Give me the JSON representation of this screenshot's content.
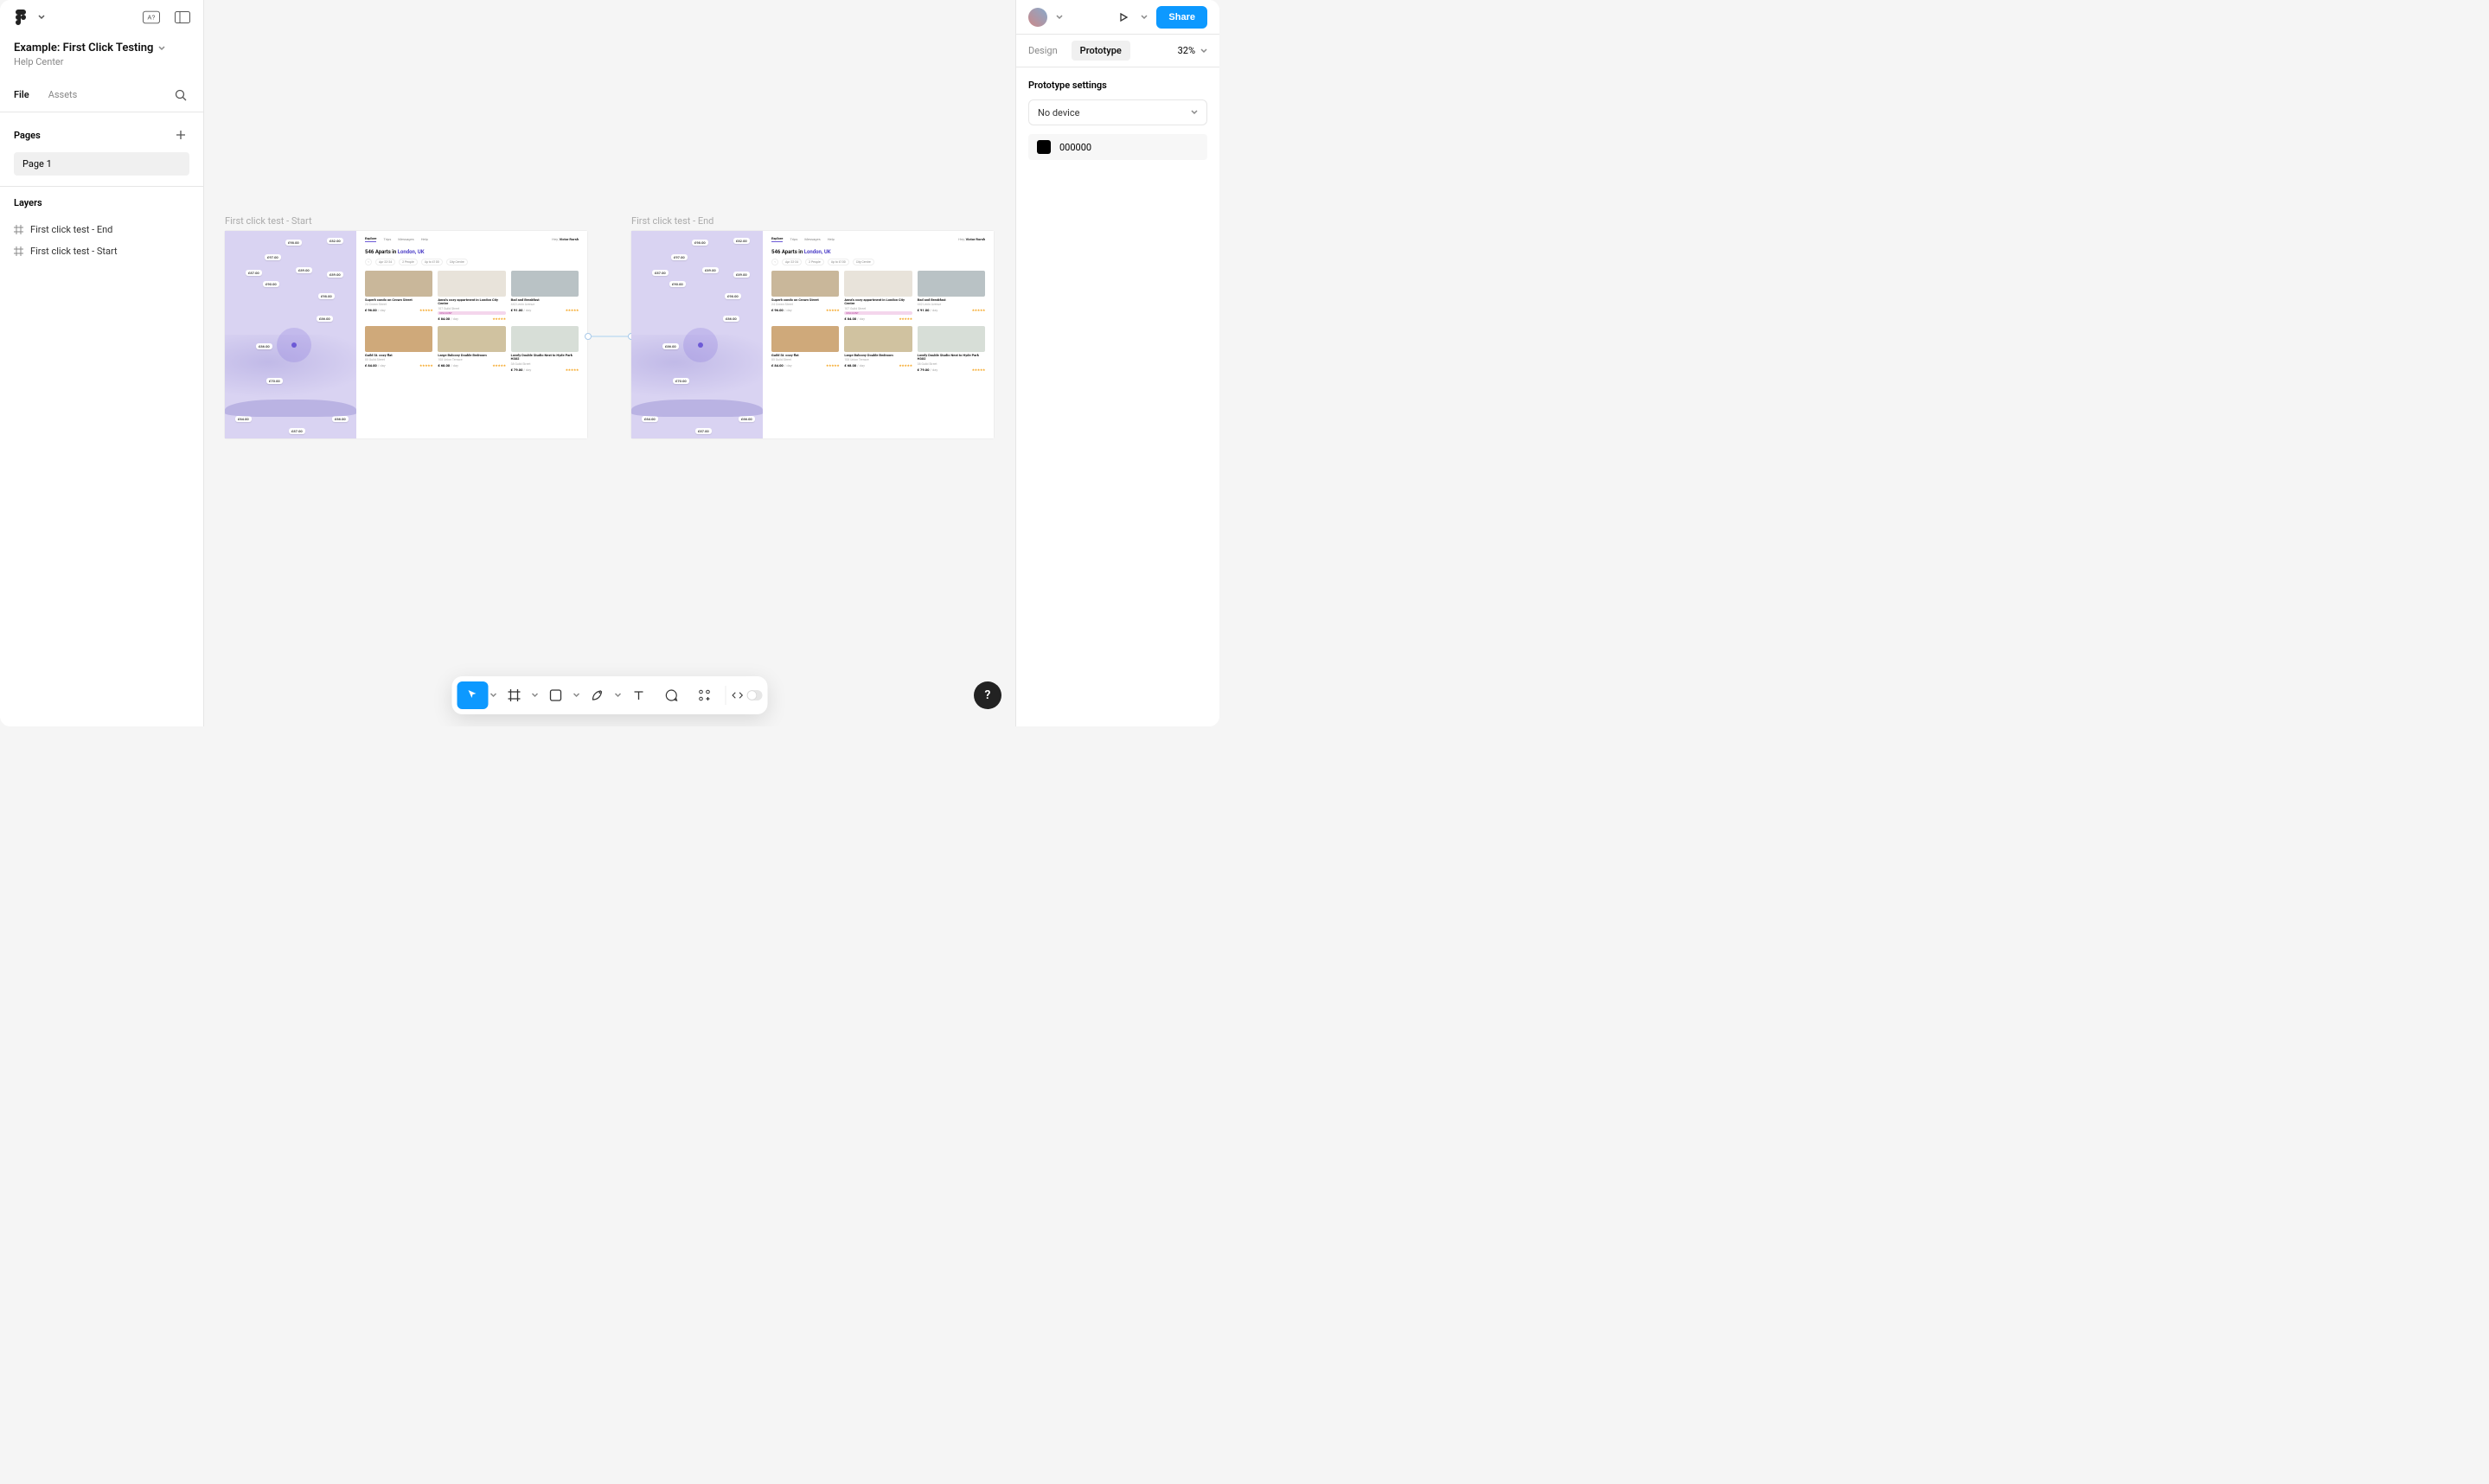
{
  "file": {
    "title": "Example: First Click Testing",
    "subtitle": "Help Center"
  },
  "left_tabs": {
    "file": "File",
    "assets": "Assets"
  },
  "pages": {
    "heading": "Pages",
    "items": [
      {
        "name": "Page 1"
      }
    ]
  },
  "layers": {
    "heading": "Layers",
    "items": [
      {
        "name": "First click test - End"
      },
      {
        "name": "First click test - Start"
      }
    ]
  },
  "canvas": {
    "frame1_label": "First click test - Start",
    "frame2_label": "First click test - End"
  },
  "booking": {
    "nav": {
      "explore": "Explore",
      "trips": "Trips",
      "messages": "Messages",
      "help": "Help"
    },
    "greeting_prefix": "Hey, ",
    "greeting_name": "Victor Rorsh",
    "title_count": "546 Aparts in ",
    "title_place": "London, UK",
    "chips": [
      "Apr 22-24",
      "2 People",
      "Up to £100",
      "City Centre"
    ],
    "map_prices": [
      "£98.00",
      "£97.00",
      "£87.00",
      "£89.00",
      "£90.00",
      "£89.00",
      "£98.00",
      "£86.00",
      "£86.00",
      "£82.00",
      "£70.00",
      "£66.00",
      "£64.00",
      "£87.00"
    ],
    "cards": [
      {
        "title": "Superb condo on Crown Street",
        "sub": "24 Crown Street",
        "price": "£ 96.00",
        "per": " / day"
      },
      {
        "title": "Anna's cozy appartment in London City Centre",
        "sub": "107 Guild Street",
        "badge": "DISCOUNT",
        "price": "£ 84.00",
        "per": " / day"
      },
      {
        "title": "Bad and Breakfast",
        "sub": "442 Lenin Avenue",
        "price": "£ 91.00",
        "per": " / day"
      },
      {
        "title": "Guild St. cozy flat",
        "sub": "85 Guild Street",
        "price": "£ 84.00",
        "per": " / day"
      },
      {
        "title": "Large Balcony Double Bedroom",
        "sub": "108 Union Terrace",
        "price": "£ 68.00",
        "per": " / day"
      },
      {
        "title": "Lovely Double Studio Next to Hyde Park H302",
        "sub": "38 Guild Street",
        "price": "£ 79.00",
        "per": " / day"
      }
    ],
    "card_colors": [
      "#c9b79a",
      "#e8e3da",
      "#b9c2c5",
      "#cfa97a",
      "#d0c2a0",
      "#d7ded7"
    ]
  },
  "right": {
    "share": "Share",
    "tabs": {
      "design": "Design",
      "prototype": "Prototype"
    },
    "zoom": "32%",
    "settings_head": "Prototype settings",
    "device": "No device",
    "bg_hex": "000000"
  },
  "help": "?"
}
